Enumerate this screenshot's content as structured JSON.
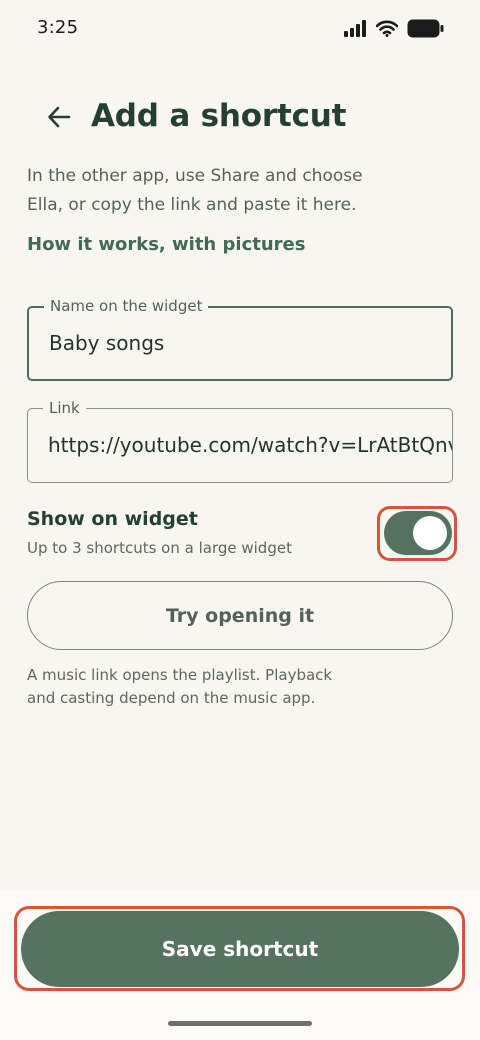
{
  "status_bar": {
    "time": "3:25",
    "icons": [
      "signal-icon",
      "wifi-icon",
      "battery-icon"
    ]
  },
  "header": {
    "back_icon": "back-arrow-icon",
    "title": "Add a shortcut"
  },
  "intro": {
    "line1": "In the other app, use Share and choose",
    "line2": "Ella, or copy the link and paste it here."
  },
  "help_link": "How it works, with pictures",
  "fields": {
    "name": {
      "label": "Name on the widget",
      "value": "Baby songs"
    },
    "link": {
      "label": "Link",
      "value": "https://youtube.com/watch?v=LrAtBtQnv"
    }
  },
  "widget_toggle": {
    "title": "Show on widget",
    "subtitle": "Up to 3 shortcuts on a large widget",
    "enabled": true
  },
  "try_button": "Try opening it",
  "note": {
    "line1": "A music link opens the playlist. Playback",
    "line2": "and casting depend on the music app."
  },
  "save_button": "Save shortcut",
  "colors": {
    "background": "#f8f6f1",
    "primary": "#55735f",
    "highlight": "#d9553a",
    "title_text": "#26402f"
  }
}
